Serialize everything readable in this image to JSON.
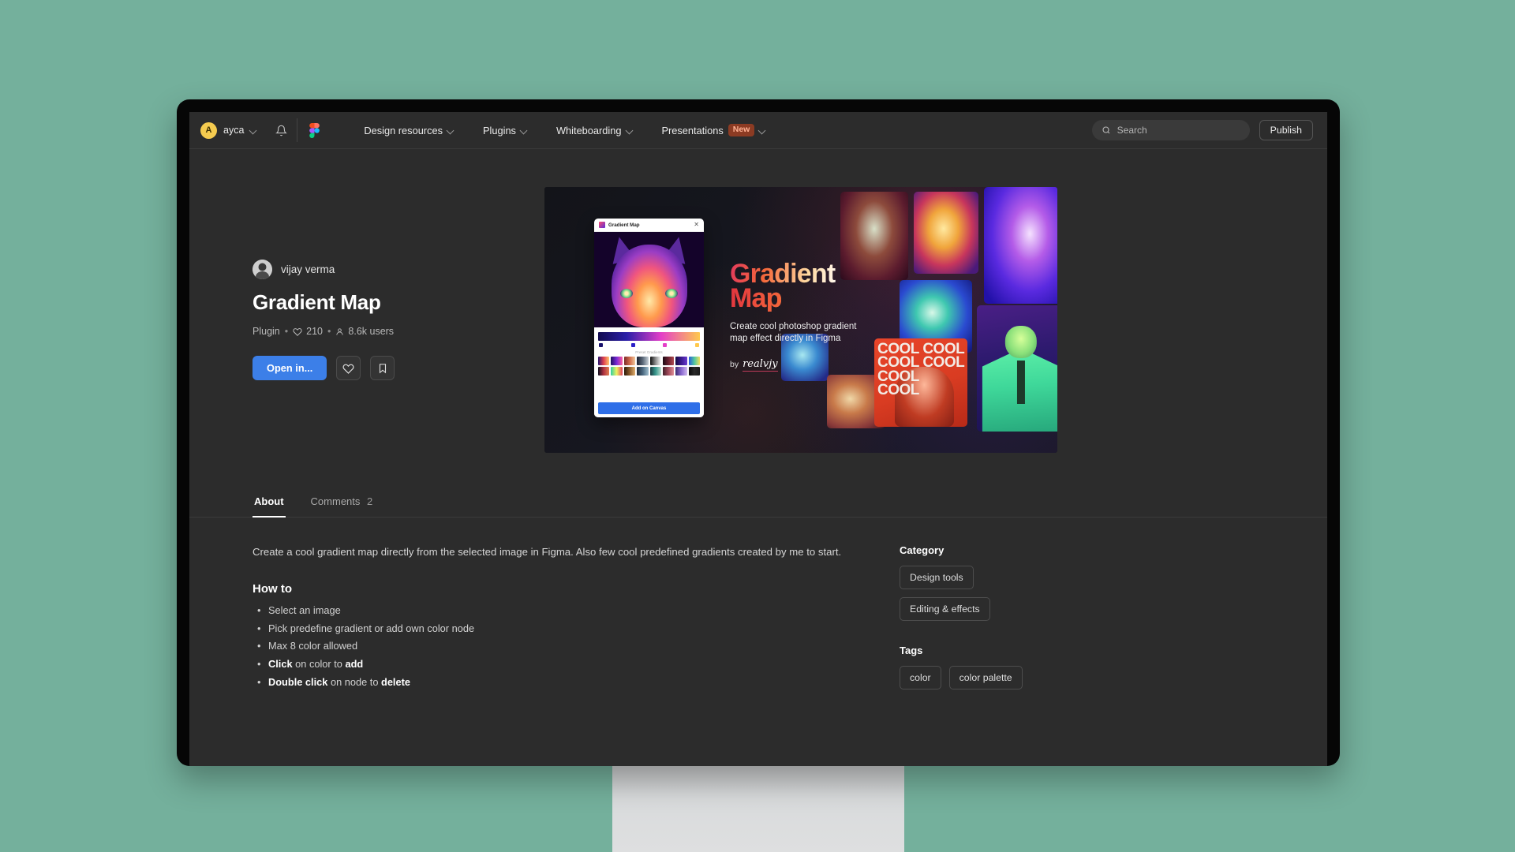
{
  "navbar": {
    "user": {
      "initial": "A",
      "name": "ayca"
    },
    "bell_icon": "bell-icon",
    "figma_logo": "figma-logo",
    "menu": [
      {
        "label": "Design resources",
        "badge": null
      },
      {
        "label": "Plugins",
        "badge": null
      },
      {
        "label": "Whiteboarding",
        "badge": null
      },
      {
        "label": "Presentations",
        "badge": "New"
      }
    ],
    "search": {
      "placeholder": "Search",
      "icon": "search-icon"
    },
    "publish_label": "Publish"
  },
  "hero": {
    "author": "vijay verma",
    "title": "Gradient Map",
    "meta": {
      "type": "Plugin",
      "sep": "•",
      "likes": "210",
      "users": "8.6k users"
    },
    "actions": {
      "open_label": "Open in...",
      "like_icon": "heart-icon",
      "save_icon": "bookmark-icon"
    }
  },
  "cover": {
    "plugin_window": {
      "title": "Gradient Map",
      "close_icon": "close-icon",
      "preset_label": "Preset Gradients",
      "add_button": "Add on Canvas"
    },
    "headline_line1": "Gradient",
    "headline_line2": "Map",
    "subtitle": "Create cool photoshop gradient map effect directly in Figma",
    "by_label": "by",
    "by_author": "realvjy",
    "tile_text": "COOL COOL COOL COOL COOL COOL"
  },
  "tabs": [
    {
      "label": "About",
      "count": null,
      "active": true
    },
    {
      "label": "Comments",
      "count": "2",
      "active": false
    }
  ],
  "about": {
    "description": "Create a cool gradient map directly from the selected image in Figma. Also few cool predefined gradients created by me to start.",
    "howto_title": "How to",
    "howto": [
      {
        "html": "Select an image"
      },
      {
        "html": "Pick predefine gradient or add own color node"
      },
      {
        "html": "Max 8 color allowed"
      },
      {
        "html": "<b>Click</b> on color to <b>add</b>"
      },
      {
        "html": "<b>Double click</b> on node to <b>delete</b>"
      }
    ]
  },
  "sidebar": {
    "category_heading": "Category",
    "categories": [
      "Design tools",
      "Editing & effects"
    ],
    "tags_heading": "Tags",
    "tags": [
      "color",
      "color palette"
    ]
  },
  "colors": {
    "background": "#74b09c",
    "screen_bg": "#2c2c2c",
    "accent_blue": "#3c7fe8",
    "cover_bg": "#14151a",
    "badge_new_bg": "#8c3b23"
  }
}
